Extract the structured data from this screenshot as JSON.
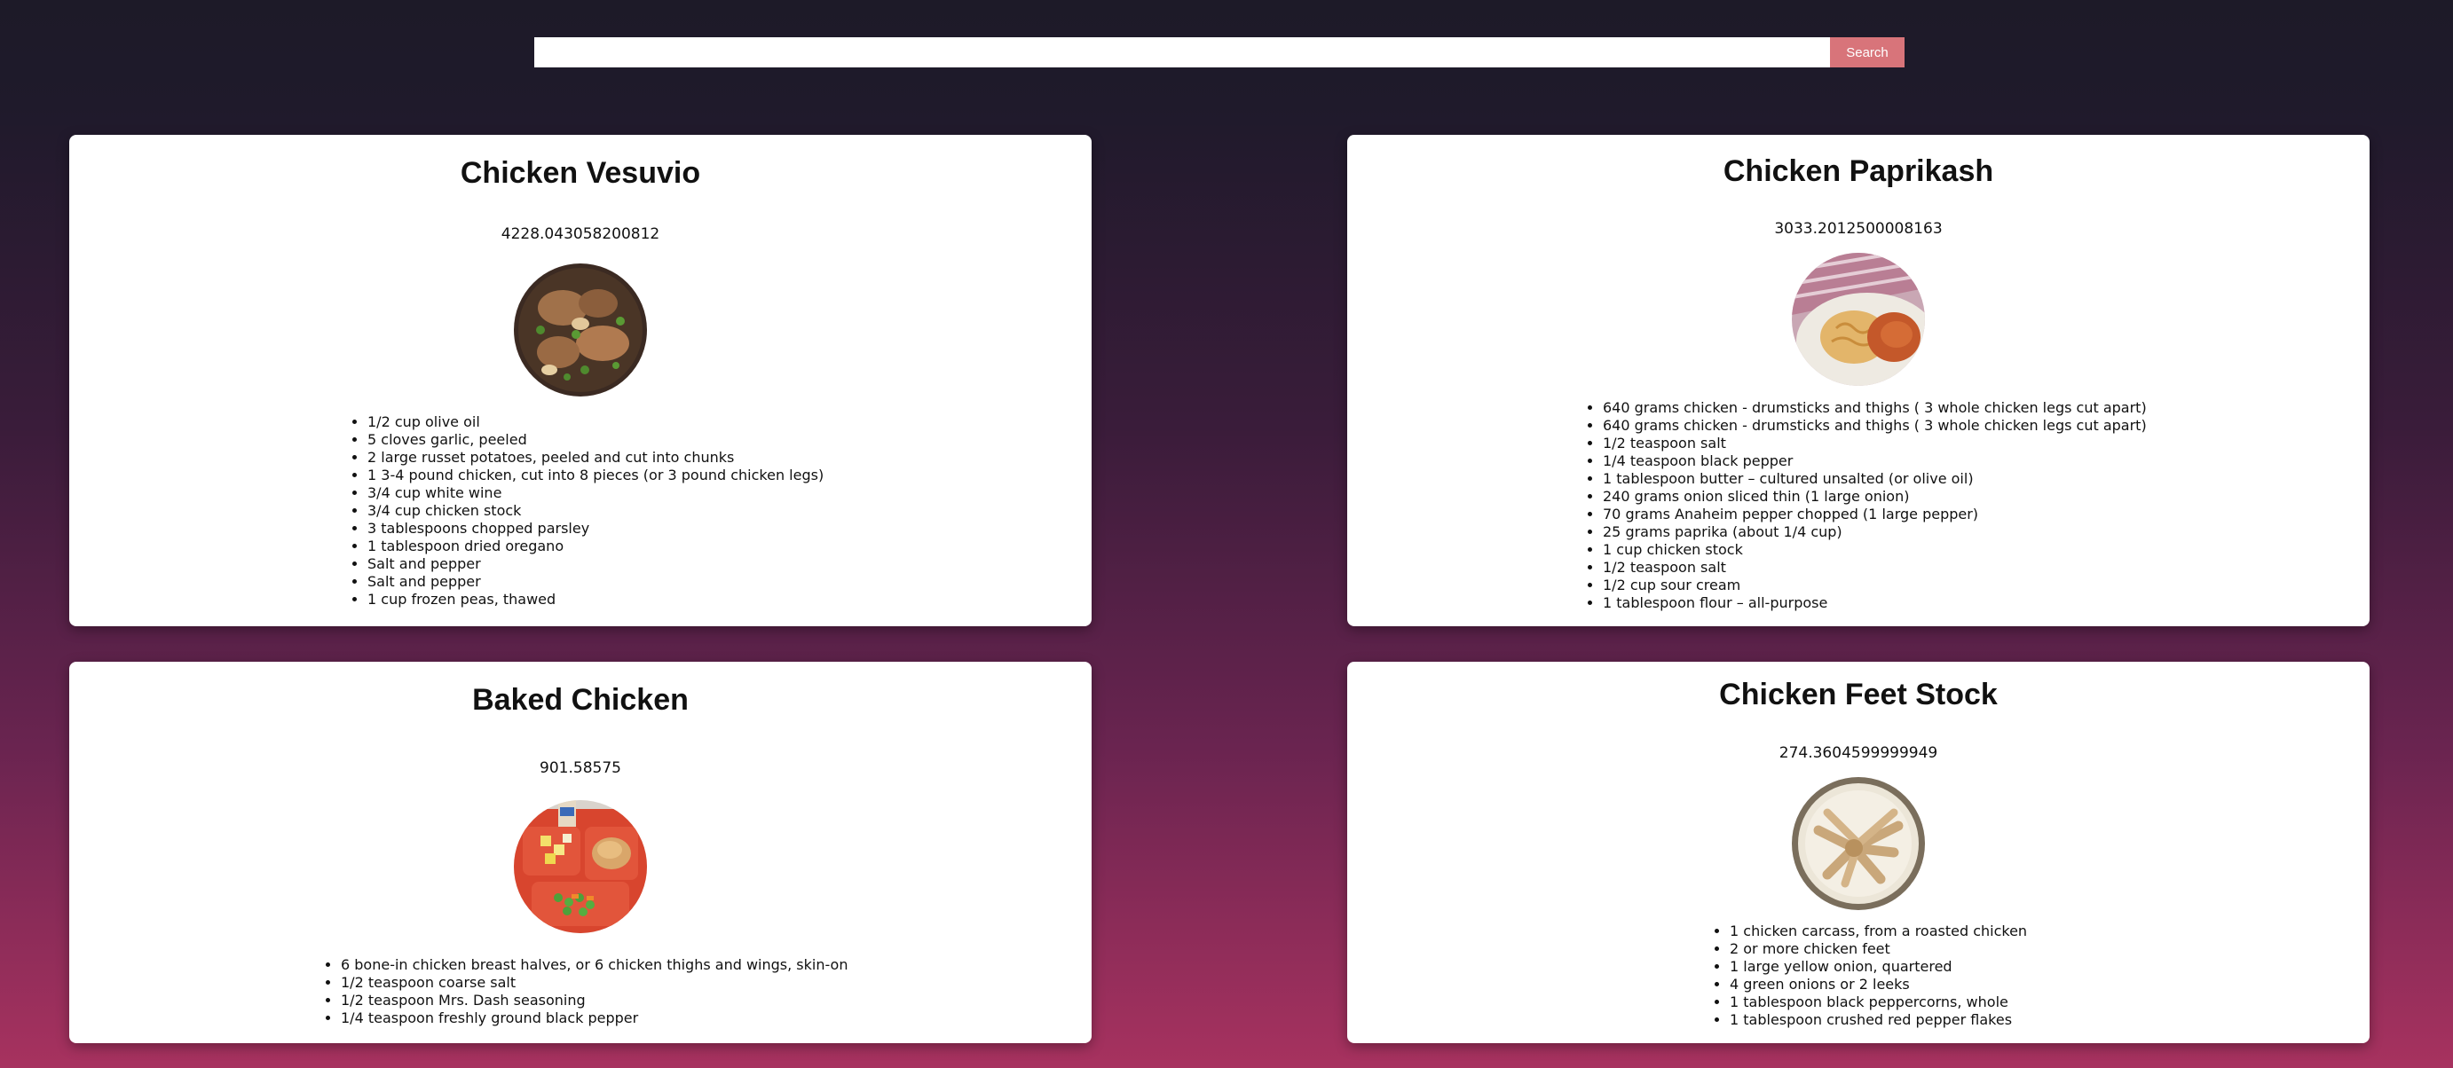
{
  "search": {
    "value": "",
    "placeholder": "",
    "button_label": "Search"
  },
  "cards": [
    {
      "title": "Chicken Vesuvio",
      "calories": "4228.043058200812",
      "image": "chicken-vesuvio-photo",
      "ingredients": [
        "1/2 cup olive oil",
        "5 cloves garlic, peeled",
        "2 large russet potatoes, peeled and cut into chunks",
        "1 3-4 pound chicken, cut into 8 pieces (or 3 pound chicken legs)",
        "3/4 cup white wine",
        "3/4 cup chicken stock",
        "3 tablespoons chopped parsley",
        "1 tablespoon dried oregano",
        "Salt and pepper",
        "Salt and pepper",
        "1 cup frozen peas, thawed"
      ]
    },
    {
      "title": "Chicken Paprikash",
      "calories": "3033.2012500008163",
      "image": "chicken-paprikash-photo",
      "ingredients": [
        "640 grams chicken - drumsticks and thighs ( 3 whole chicken legs cut apart)",
        "640 grams chicken - drumsticks and thighs ( 3 whole chicken legs cut apart)",
        "1/2 teaspoon salt",
        "1/4 teaspoon black pepper",
        "1 tablespoon butter – cultured unsalted (or olive oil)",
        "240 grams onion sliced thin (1 large onion)",
        "70 grams Anaheim pepper chopped (1 large pepper)",
        "25 grams paprika (about 1/4 cup)",
        "1 cup chicken stock",
        "1/2 teaspoon salt",
        "1/2 cup sour cream",
        "1 tablespoon flour – all-purpose"
      ]
    },
    {
      "title": "Baked Chicken",
      "calories": "901.58575",
      "image": "baked-chicken-photo",
      "ingredients": [
        "6 bone-in chicken breast halves, or 6 chicken thighs and wings, skin-on",
        "1/2 teaspoon coarse salt",
        "1/2 teaspoon Mrs. Dash seasoning",
        "1/4 teaspoon freshly ground black pepper"
      ]
    },
    {
      "title": "Chicken Feet Stock",
      "calories": "274.3604599999949",
      "image": "chicken-feet-stock-photo",
      "ingredients": [
        "1 chicken carcass, from a roasted chicken",
        "2 or more chicken feet",
        "1 large yellow onion, quartered",
        "4 green onions or 2 leeks",
        "1 tablespoon black peppercorns, whole",
        "1 tablespoon crushed red pepper flakes"
      ]
    }
  ]
}
